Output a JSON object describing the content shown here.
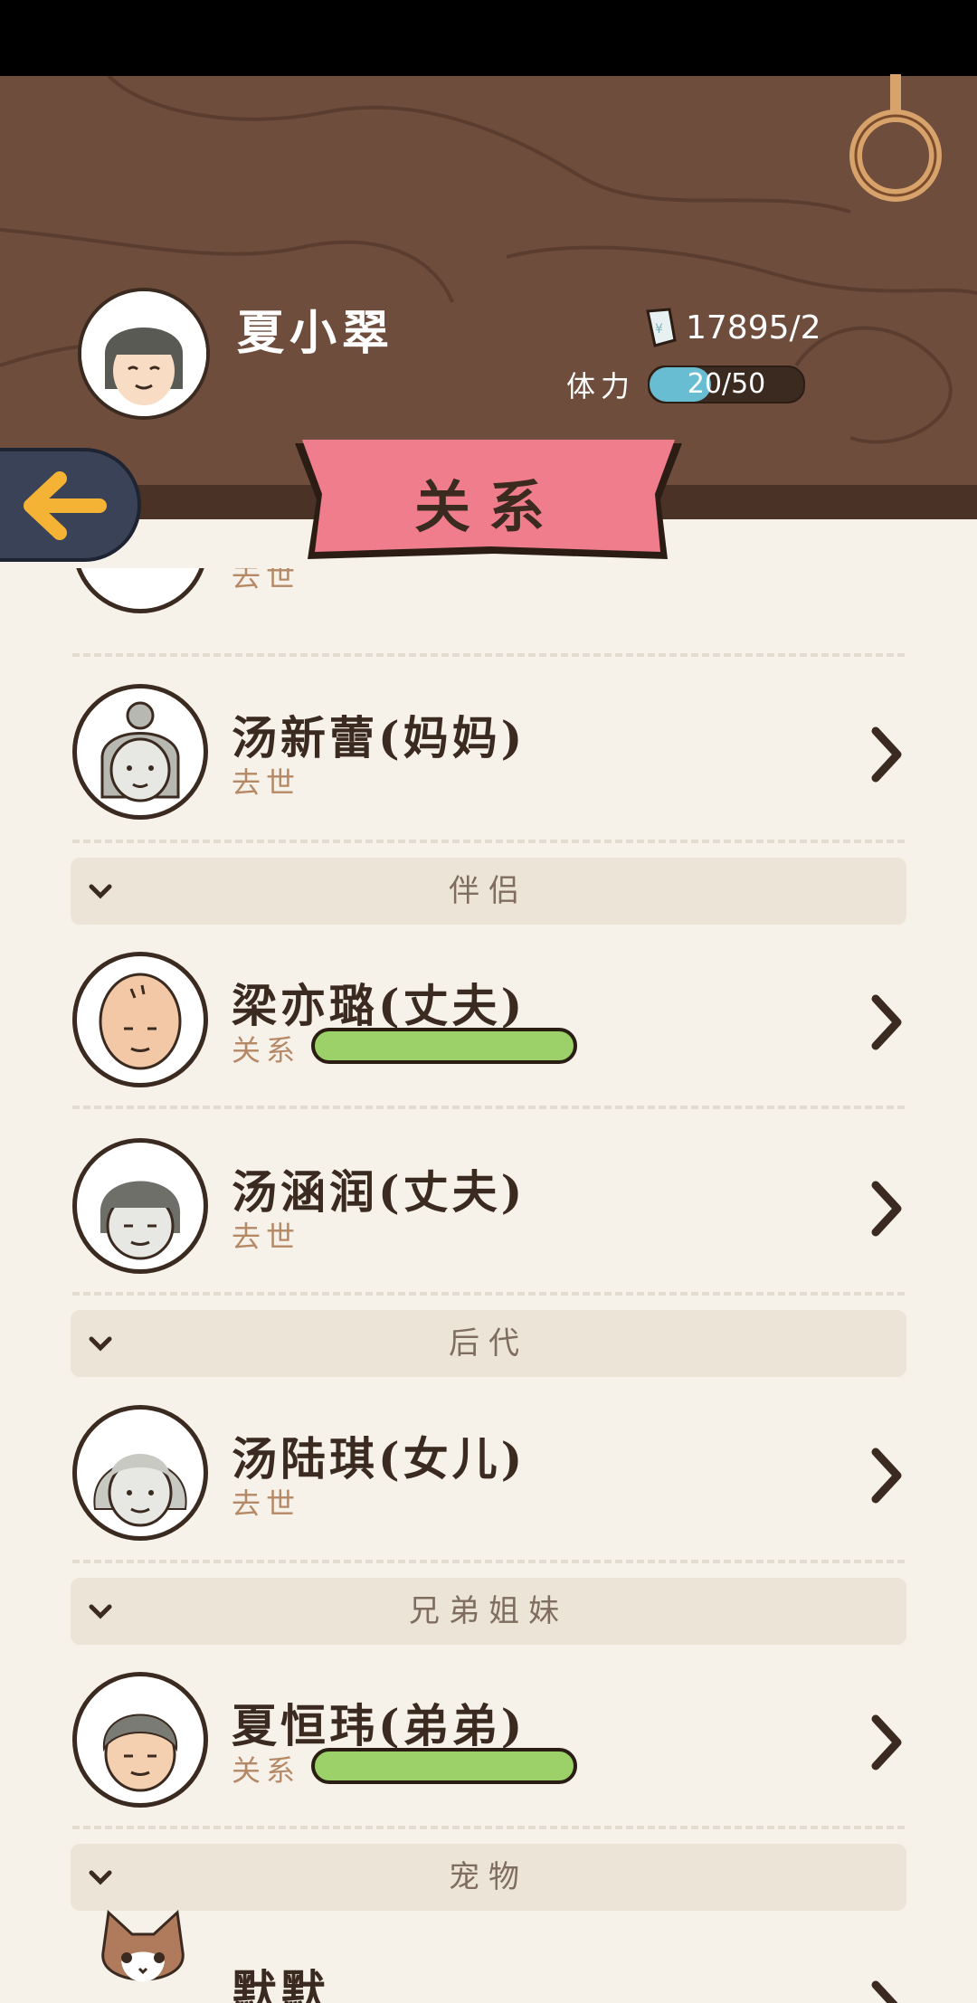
{
  "status_bar": {},
  "player": {
    "name": "夏小翠",
    "money": "17895/2",
    "stamina_label": "体力",
    "stamina_value": "20/50",
    "stamina_fraction": 0.4
  },
  "page": {
    "title": "关系"
  },
  "top_partial": {
    "status": "去世"
  },
  "rows": [
    {
      "id": "mother",
      "name": "汤新蕾(妈妈)",
      "status": "去世"
    },
    {
      "id": "husband1",
      "name": "梁亦璐(丈夫)",
      "status": "关系",
      "relation_level": 1.0
    },
    {
      "id": "husband2",
      "name": "汤涵润(丈夫)",
      "status": "去世"
    },
    {
      "id": "daughter",
      "name": "汤陆琪(女儿)",
      "status": "去世"
    },
    {
      "id": "brother",
      "name": "夏恒玮(弟弟)",
      "status": "关系",
      "relation_level": 1.0
    },
    {
      "id": "pet",
      "name": "默默"
    }
  ],
  "sections": [
    {
      "label": "伴侣"
    },
    {
      "label": "后代"
    },
    {
      "label": "兄弟姐妹"
    },
    {
      "label": "宠物"
    }
  ],
  "icons": {
    "back": "arrow-left-icon",
    "row_action": "chevron-right-icon",
    "section_toggle": "chevron-down-icon",
    "money": "money-note-icon",
    "settings": "ring-icon"
  },
  "colors": {
    "header_wood": "#6f4d3d",
    "banner": "#f07d8c",
    "relation_bar": "#9bd168",
    "stamina_bar": "#69bdd2",
    "back_button": "#3a4257",
    "back_arrow": "#f5b335"
  }
}
